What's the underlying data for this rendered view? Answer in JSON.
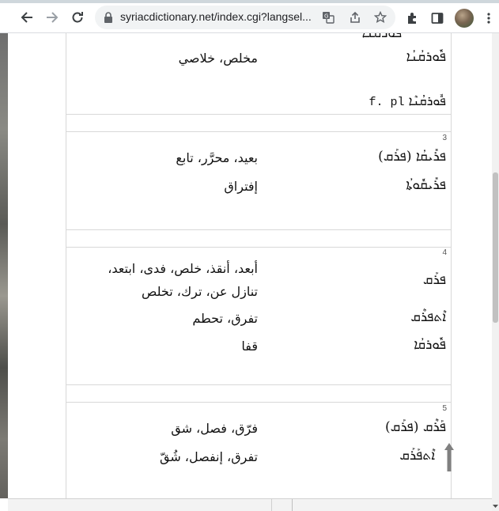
{
  "browser": {
    "url": "syriacdictionary.net/index.cgi?langsel...",
    "icons": [
      "back-arrow-icon",
      "forward-arrow-icon",
      "reload-icon",
      "lock-icon",
      "translate-icon",
      "share-icon",
      "star-icon",
      "extensions-puzzle-icon",
      "side-panel-icon",
      "profile-avatar",
      "kebab-menu-icon"
    ]
  },
  "colors": {
    "scroll_arrow": "#808080",
    "border": "#d8d8d8"
  },
  "entries": {
    "top": {
      "cut": "ܦܘܪܩܢܐ",
      "row1": {
        "syriac": "ܦܽܘܪܩܳܢܳܐ",
        "arabic": "مخلص، خلاصي"
      },
      "plural": {
        "syriac": "ܦܽܘܪܩܳܢܶܐ",
        "suffix": "f. pl"
      }
    },
    "e3": {
      "num": "3",
      "row1": {
        "syriac": "ܦܪܺܝܩܳܐ (ܦܪܰܩ)",
        "arabic": "بعيد، محرَّر، تابع"
      },
      "row2": {
        "syriac": "ܦܪܺܝܩܽܘܬܳܐ",
        "arabic": "إفتراق"
      }
    },
    "e4": {
      "num": "4",
      "row1": {
        "syriac": "ܦܪܰܩ",
        "arabic_line1": "أبعد، أنقذ، خلص، فدى، ابتعد،",
        "arabic_line2": "تنازل عن، ترك، تخلص"
      },
      "row2": {
        "syriac": "ܐܶܬܦܪܶܩ",
        "arabic": "تفرق، تحطم"
      },
      "row3": {
        "syriac": "ܦܽܘܪܩܳܐ",
        "arabic": "قفا"
      }
    },
    "e5": {
      "num": "5",
      "row1": {
        "syriac": "ܦܰܪܶܩ (ܦܪܰܩ)",
        "arabic": "فرّق، فصل، شق"
      },
      "row2": {
        "syriac": "ܐܶܬܦܰܪܰܩ",
        "arabic": "تفرق، إنفصل، شُقّ"
      }
    }
  }
}
